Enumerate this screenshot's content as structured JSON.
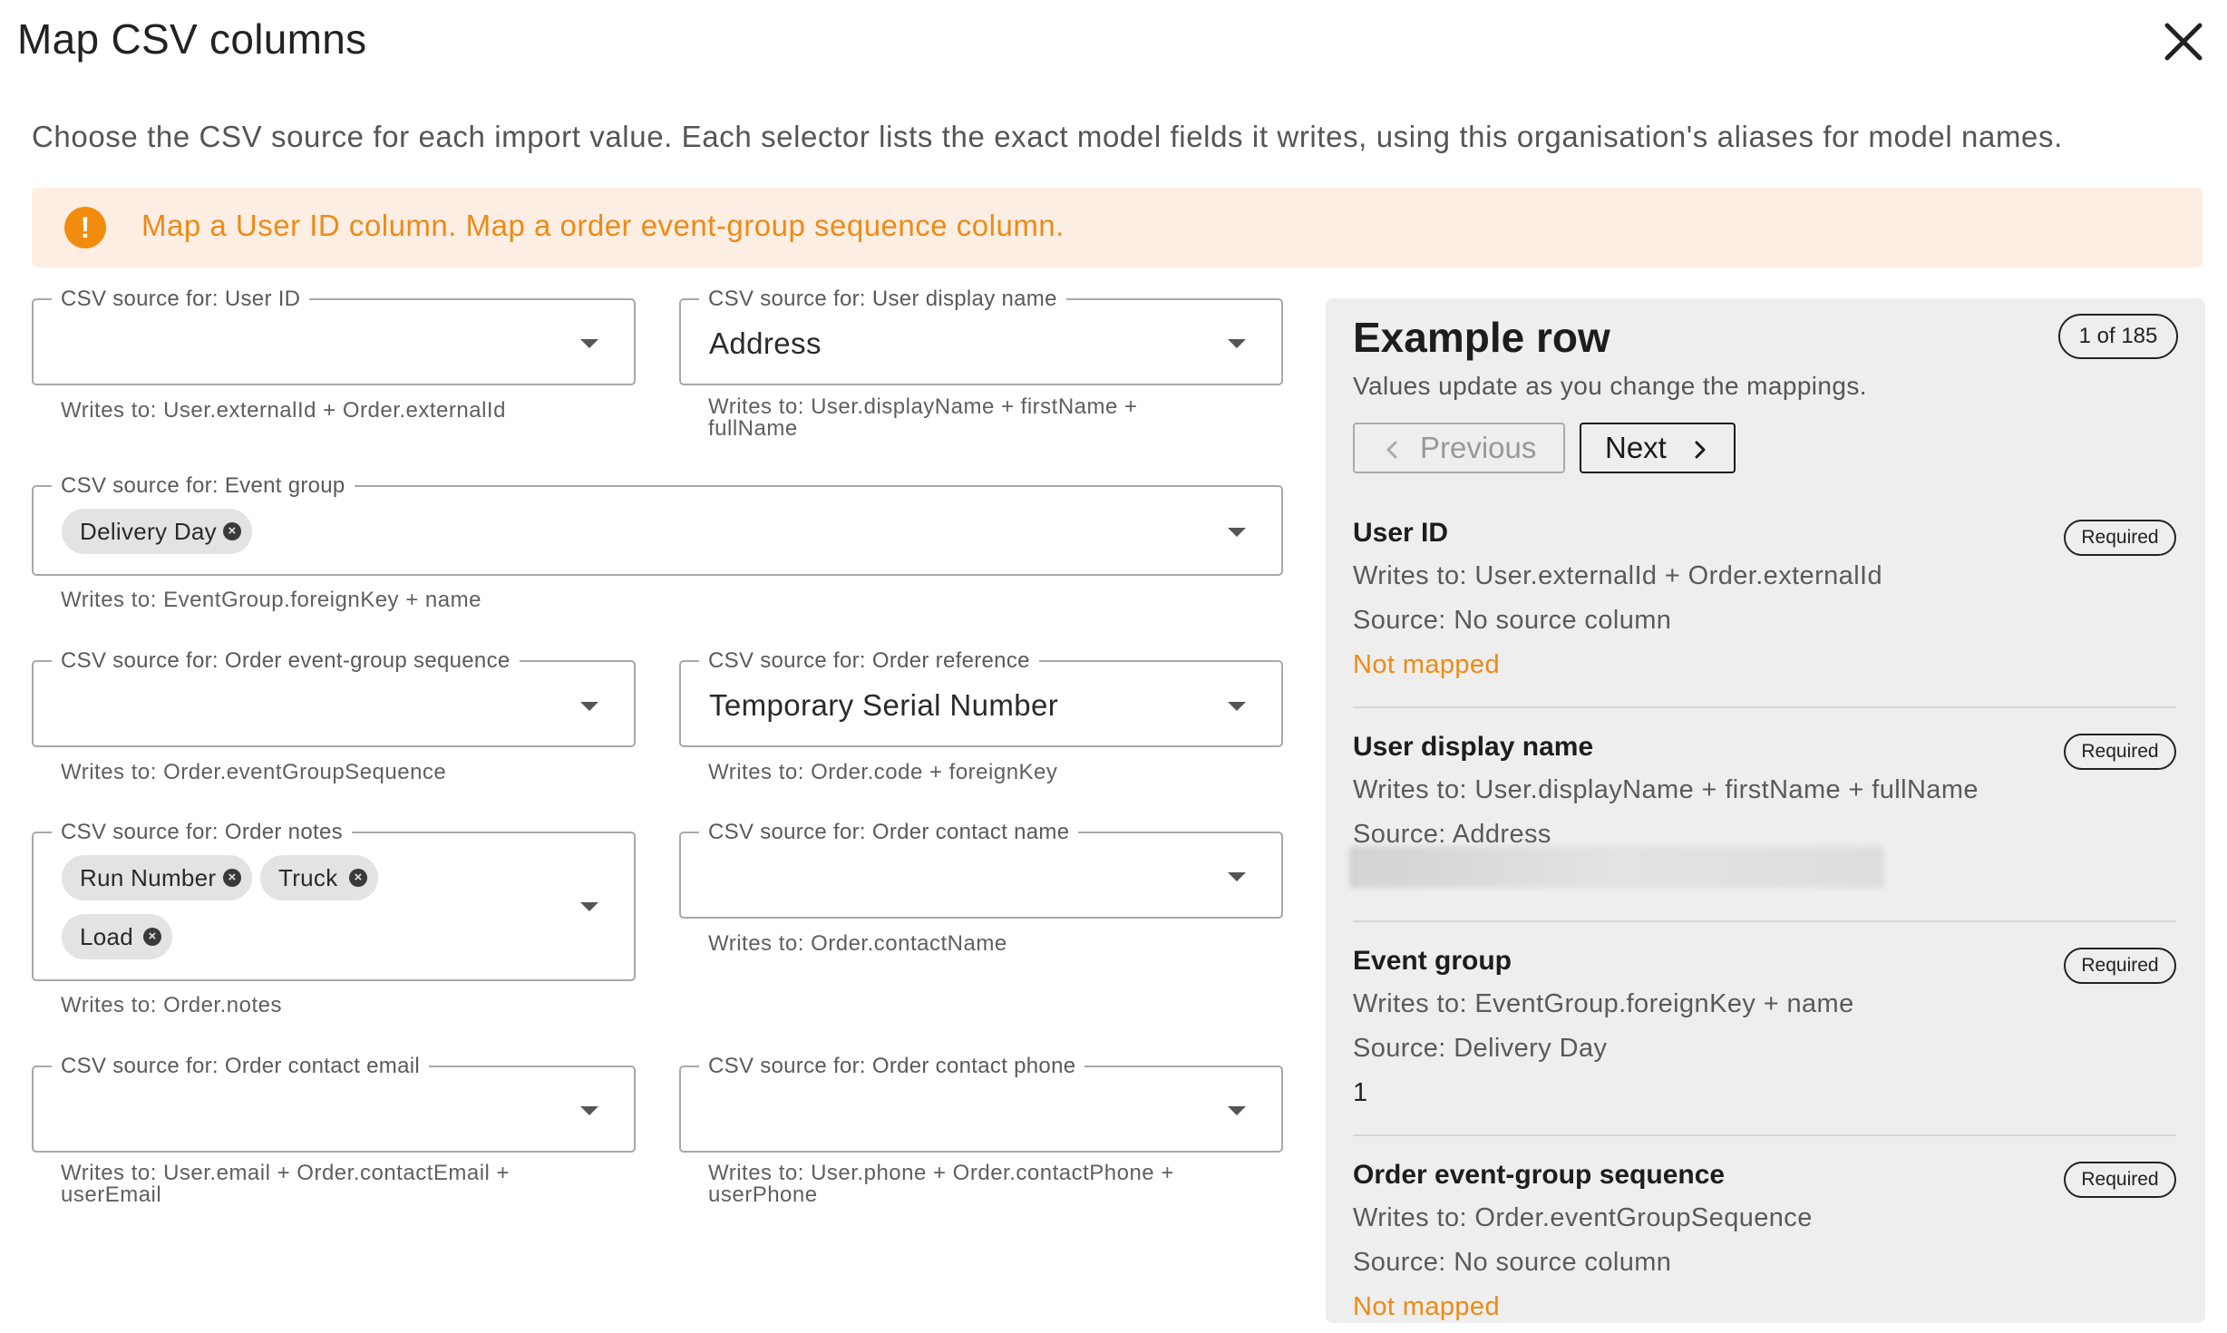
{
  "dialog": {
    "title": "Map CSV columns",
    "description": "Choose the CSV source for each import value. Each selector lists the exact model fields it writes, using this organisation's aliases for model names.",
    "close_icon": "close-icon"
  },
  "warning": {
    "icon": "exclamation-icon",
    "text": "Map a User ID column. Map a order event-group sequence column.",
    "color": "#ee8a15"
  },
  "fields": {
    "user_id": {
      "label": "CSV source for: User ID",
      "value": "",
      "helper": "Writes to: User.externalId + Order.externalId"
    },
    "user_display_name": {
      "label": "CSV source for: User display name",
      "value": "Address",
      "helper_line1": "Writes to: User.displayName + firstName +",
      "helper_line2": "fullName"
    },
    "event_group": {
      "label": "CSV source for: Event group",
      "chips": [
        "Delivery Day"
      ],
      "helper": "Writes to: EventGroup.foreignKey + name"
    },
    "order_sequence": {
      "label": "CSV source for: Order event-group sequence",
      "value": "",
      "helper": "Writes to: Order.eventGroupSequence"
    },
    "order_reference": {
      "label": "CSV source for: Order reference",
      "value": "Temporary Serial Number",
      "helper": "Writes to: Order.code + foreignKey"
    },
    "order_notes": {
      "label": "CSV source for: Order notes",
      "chips": [
        "Run Number",
        "Truck",
        "Load"
      ],
      "helper": "Writes to: Order.notes"
    },
    "order_contact_name": {
      "label": "CSV source for: Order contact name",
      "value": "",
      "helper": "Writes to: Order.contactName"
    },
    "order_contact_email": {
      "label": "CSV source for: Order contact email",
      "value": "",
      "helper_line1": "Writes to: User.email + Order.contactEmail +",
      "helper_line2": "userEmail"
    },
    "order_contact_phone": {
      "label": "CSV source for: Order contact phone",
      "value": "",
      "helper_line1": "Writes to: User.phone + Order.contactPhone +",
      "helper_line2": "userPhone"
    }
  },
  "example": {
    "title": "Example row",
    "subtitle": "Values update as you change the mappings.",
    "page_count": "1 of 185",
    "previous_label": "Previous",
    "next_label": "Next",
    "entries": [
      {
        "title": "User ID",
        "badge": "Required",
        "writes": "Writes to: User.externalId + Order.externalId",
        "source": "Source: No source column",
        "status": "Not mapped"
      },
      {
        "title": "User display name",
        "badge": "Required",
        "writes": "Writes to: User.displayName + firstName + fullName",
        "source": "Source: Address",
        "value": ""
      },
      {
        "title": "Event group",
        "badge": "Required",
        "writes": "Writes to: EventGroup.foreignKey + name",
        "source": "Source: Delivery Day",
        "value": "1"
      },
      {
        "title": "Order event-group sequence",
        "badge": "Required",
        "writes": "Writes to: Order.eventGroupSequence",
        "source": "Source: No source column",
        "status": "Not mapped"
      }
    ]
  }
}
